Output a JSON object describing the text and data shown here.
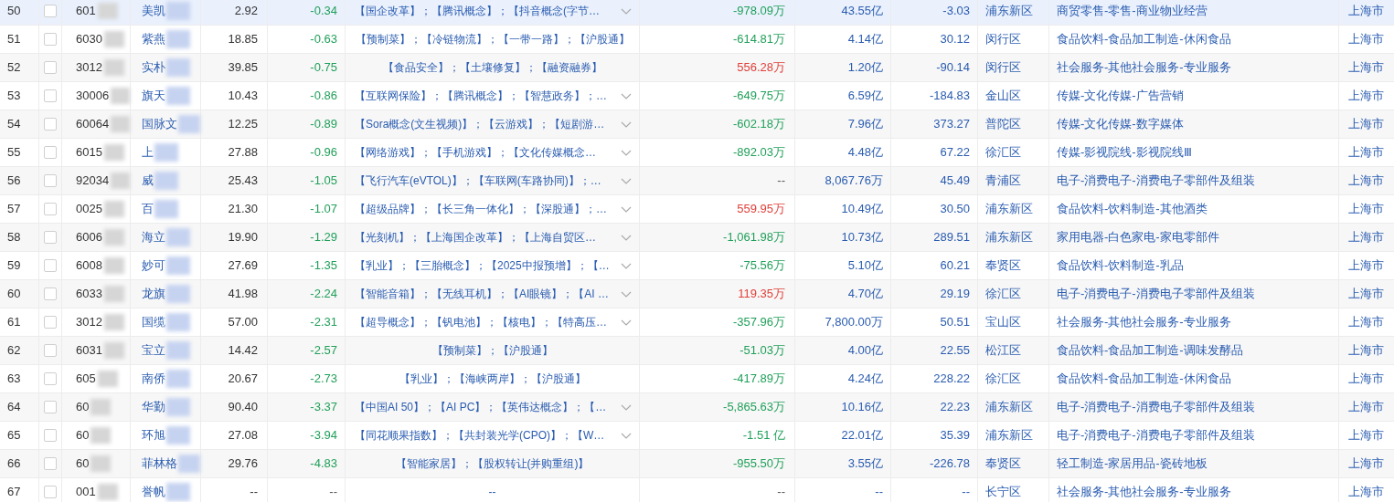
{
  "rows": [
    {
      "index": "50",
      "selected": true,
      "checked": false,
      "code": "601",
      "name": "美凯",
      "price": "2.92",
      "change": {
        "text": "-0.34",
        "color": "#21a05a"
      },
      "concepts": "【国企改革】；【腾讯概念】；【抖音概念(字节…",
      "expandable": true,
      "net_flow": {
        "text": "-978.09万",
        "color": "#21a05a"
      },
      "market_cap": "43.55亿",
      "pe": "-3.03",
      "district": "浦东新区",
      "industry": "商贸零售-零售-商业物业经营",
      "city": "上海市"
    },
    {
      "index": "51",
      "selected": false,
      "checked": false,
      "code": "6030",
      "name": "紫燕",
      "price": "18.85",
      "change": {
        "text": "-0.63",
        "color": "#21a05a"
      },
      "concepts": "【预制菜】；【冷链物流】；【一带一路】；【沪股通】",
      "expandable": false,
      "net_flow": {
        "text": "-614.81万",
        "color": "#21a05a"
      },
      "market_cap": "4.14亿",
      "pe": "30.12",
      "district": "闵行区",
      "industry": "食品饮料-食品加工制造-休闲食品",
      "city": "上海市"
    },
    {
      "index": "52",
      "selected": false,
      "checked": false,
      "code": "3012",
      "name": "实朴",
      "price": "39.85",
      "change": {
        "text": "-0.75",
        "color": "#21a05a"
      },
      "concepts": "【食品安全】；【土壤修复】；【融资融券】",
      "expandable": false,
      "net_flow": {
        "text": "556.28万",
        "color": "#e0403a"
      },
      "market_cap": "1.20亿",
      "pe": "-90.14",
      "district": "闵行区",
      "industry": "社会服务-其他社会服务-专业服务",
      "city": "上海市"
    },
    {
      "index": "53",
      "selected": false,
      "checked": false,
      "code": "30006",
      "name": "旗天",
      "price": "10.43",
      "change": {
        "text": "-0.86",
        "color": "#21a05a"
      },
      "concepts": "【互联网保险】；【腾讯概念】；【智慧政务】；…",
      "expandable": true,
      "net_flow": {
        "text": "-649.75万",
        "color": "#21a05a"
      },
      "market_cap": "6.59亿",
      "pe": "-184.83",
      "district": "金山区",
      "industry": "传媒-文化传媒-广告营销",
      "city": "上海市"
    },
    {
      "index": "54",
      "selected": false,
      "checked": false,
      "code": "60064",
      "name": "国脉文",
      "price": "12.25",
      "change": {
        "text": "-0.89",
        "color": "#21a05a"
      },
      "concepts": "【Sora概念(文生视频)】；【云游戏】；【短剧游…",
      "expandable": true,
      "net_flow": {
        "text": "-602.18万",
        "color": "#21a05a"
      },
      "market_cap": "7.96亿",
      "pe": "373.27",
      "district": "普陀区",
      "industry": "传媒-文化传媒-数字媒体",
      "city": "上海市"
    },
    {
      "index": "55",
      "selected": false,
      "checked": false,
      "code": "6015",
      "name": "上",
      "price": "27.88",
      "change": {
        "text": "-0.96",
        "color": "#21a05a"
      },
      "concepts": "【网络游戏】；【手机游戏】；【文化传媒概念…",
      "expandable": true,
      "net_flow": {
        "text": "-892.03万",
        "color": "#21a05a"
      },
      "market_cap": "4.48亿",
      "pe": "67.22",
      "district": "徐汇区",
      "industry": "传媒-影视院线-影视院线Ⅲ",
      "city": "上海市"
    },
    {
      "index": "56",
      "selected": false,
      "checked": false,
      "code": "92034",
      "name": "威",
      "price": "25.43",
      "change": {
        "text": "-1.05",
        "color": "#21a05a"
      },
      "concepts": "【飞行汽车(eVTOL)】；【车联网(车路协同)】；…",
      "expandable": true,
      "net_flow": {
        "text": "--",
        "color": "#555555"
      },
      "market_cap": "8,067.76万",
      "pe": "45.49",
      "district": "青浦区",
      "industry": "电子-消费电子-消费电子零部件及组装",
      "city": "上海市"
    },
    {
      "index": "57",
      "selected": false,
      "checked": false,
      "code": "0025",
      "name": "百",
      "price": "21.30",
      "change": {
        "text": "-1.07",
        "color": "#21a05a"
      },
      "concepts": "【超级品牌】；【长三角一体化】；【深股通】；…",
      "expandable": true,
      "net_flow": {
        "text": "559.95万",
        "color": "#e0403a"
      },
      "market_cap": "10.49亿",
      "pe": "30.50",
      "district": "浦东新区",
      "industry": "食品饮料-饮料制造-其他酒类",
      "city": "上海市"
    },
    {
      "index": "58",
      "selected": false,
      "checked": false,
      "code": "6006",
      "name": "海立",
      "price": "19.90",
      "change": {
        "text": "-1.29",
        "color": "#21a05a"
      },
      "concepts": "【光刻机】；【上海国企改革】；【上海自贸区…",
      "expandable": true,
      "net_flow": {
        "text": "-1,061.98万",
        "color": "#21a05a"
      },
      "market_cap": "10.73亿",
      "pe": "289.51",
      "district": "浦东新区",
      "industry": "家用电器-白色家电-家电零部件",
      "city": "上海市"
    },
    {
      "index": "59",
      "selected": false,
      "checked": false,
      "code": "6008",
      "name": "妙可",
      "price": "27.69",
      "change": {
        "text": "-1.35",
        "color": "#21a05a"
      },
      "concepts": "【乳业】；【三胎概念】；【2025中报预增】；【…",
      "expandable": true,
      "net_flow": {
        "text": "-75.56万",
        "color": "#21a05a"
      },
      "market_cap": "5.10亿",
      "pe": "60.21",
      "district": "奉贤区",
      "industry": "食品饮料-饮料制造-乳品",
      "city": "上海市"
    },
    {
      "index": "60",
      "selected": false,
      "checked": false,
      "code": "6033",
      "name": "龙旗",
      "price": "41.98",
      "change": {
        "text": "-2.24",
        "color": "#21a05a"
      },
      "concepts": "【智能音箱】；【无线耳机】；【AI眼镜】；【AI …",
      "expandable": true,
      "net_flow": {
        "text": "119.35万",
        "color": "#e0403a"
      },
      "market_cap": "4.70亿",
      "pe": "29.19",
      "district": "徐汇区",
      "industry": "电子-消费电子-消费电子零部件及组装",
      "city": "上海市"
    },
    {
      "index": "61",
      "selected": false,
      "checked": false,
      "code": "3012",
      "name": "国缆",
      "price": "57.00",
      "change": {
        "text": "-2.31",
        "color": "#21a05a"
      },
      "concepts": "【超导概念】；【钒电池】；【核电】；【特高压…",
      "expandable": true,
      "net_flow": {
        "text": "-357.96万",
        "color": "#21a05a"
      },
      "market_cap": "7,800.00万",
      "pe": "50.51",
      "district": "宝山区",
      "industry": "社会服务-其他社会服务-专业服务",
      "city": "上海市"
    },
    {
      "index": "62",
      "selected": false,
      "checked": false,
      "code": "6031",
      "name": "宝立",
      "price": "14.42",
      "change": {
        "text": "-2.57",
        "color": "#21a05a"
      },
      "concepts": "【预制菜】；【沪股通】",
      "expandable": false,
      "net_flow": {
        "text": "-51.03万",
        "color": "#21a05a"
      },
      "market_cap": "4.00亿",
      "pe": "22.55",
      "district": "松江区",
      "industry": "食品饮料-食品加工制造-调味发酵品",
      "city": "上海市"
    },
    {
      "index": "63",
      "selected": false,
      "checked": false,
      "code": "605",
      "name": "南侨",
      "price": "20.67",
      "change": {
        "text": "-2.73",
        "color": "#21a05a"
      },
      "concepts": "【乳业】；【海峡两岸】；【沪股通】",
      "expandable": false,
      "net_flow": {
        "text": "-417.89万",
        "color": "#21a05a"
      },
      "market_cap": "4.24亿",
      "pe": "228.22",
      "district": "徐汇区",
      "industry": "食品饮料-食品加工制造-休闲食品",
      "city": "上海市"
    },
    {
      "index": "64",
      "selected": false,
      "checked": false,
      "code": "60",
      "name": "华勤",
      "price": "90.40",
      "change": {
        "text": "-3.37",
        "color": "#21a05a"
      },
      "concepts": "【中国AI 50】；【AI PC】；【英伟达概念】；【…",
      "expandable": true,
      "net_flow": {
        "text": "-5,865.63万",
        "color": "#21a05a"
      },
      "market_cap": "10.16亿",
      "pe": "22.23",
      "district": "浦东新区",
      "industry": "电子-消费电子-消费电子零部件及组装",
      "city": "上海市"
    },
    {
      "index": "65",
      "selected": false,
      "checked": false,
      "code": "60",
      "name": "环旭",
      "price": "27.08",
      "change": {
        "text": "-3.94",
        "color": "#21a05a"
      },
      "concepts": "【同花顺果指数】；【共封装光学(CPO)】；【W…",
      "expandable": true,
      "net_flow": {
        "text": "-1.51 亿",
        "color": "#21a05a"
      },
      "market_cap": "22.01亿",
      "pe": "35.39",
      "district": "浦东新区",
      "industry": "电子-消费电子-消费电子零部件及组装",
      "city": "上海市"
    },
    {
      "index": "66",
      "selected": false,
      "checked": false,
      "code": "60",
      "name": "菲林格",
      "price": "29.76",
      "change": {
        "text": "-4.83",
        "color": "#21a05a"
      },
      "concepts": "【智能家居】；【股权转让(并购重组)】",
      "expandable": false,
      "net_flow": {
        "text": "-955.50万",
        "color": "#21a05a"
      },
      "market_cap": "3.55亿",
      "pe": "-226.78",
      "district": "奉贤区",
      "industry": "轻工制造-家居用品-瓷砖地板",
      "city": "上海市"
    },
    {
      "index": "67",
      "selected": false,
      "checked": false,
      "code": "001",
      "name": "誉帆",
      "price": "--",
      "change": {
        "text": "--",
        "color": "#555555"
      },
      "concepts": "--",
      "expandable": false,
      "net_flow": {
        "text": "--",
        "color": "#555555"
      },
      "market_cap": "--",
      "pe": "--",
      "district": "长宁区",
      "industry": "社会服务-其他社会服务-专业服务",
      "city": "上海市"
    }
  ]
}
